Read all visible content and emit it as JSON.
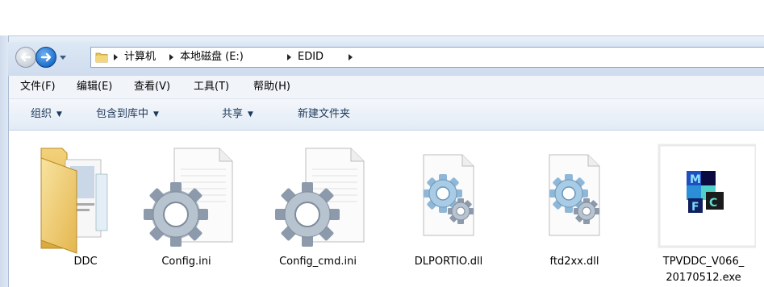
{
  "address_bar": {
    "breadcrumbs": [
      "计算机",
      "本地磁盘 (E:)",
      "EDID"
    ]
  },
  "menu": {
    "items": [
      "文件(F)",
      "编辑(E)",
      "查看(V)",
      "工具(T)",
      "帮助(H)"
    ]
  },
  "toolbar": {
    "organize": "组织",
    "include_in_library": "包含到库中",
    "share": "共享",
    "new_folder": "新建文件夹"
  },
  "files": [
    {
      "name": "DDC",
      "type": "folder"
    },
    {
      "name": "Config.ini",
      "type": "settings-file"
    },
    {
      "name": "Config_cmd.ini",
      "type": "settings-file"
    },
    {
      "name": "DLPORTIO.dll",
      "type": "dll-file"
    },
    {
      "name": "ftd2xx.dll",
      "type": "dll-file"
    },
    {
      "name_line1": "TPVDDC_V066_",
      "name_line2": "20170512.exe",
      "type": "mfc-exe"
    }
  ]
}
